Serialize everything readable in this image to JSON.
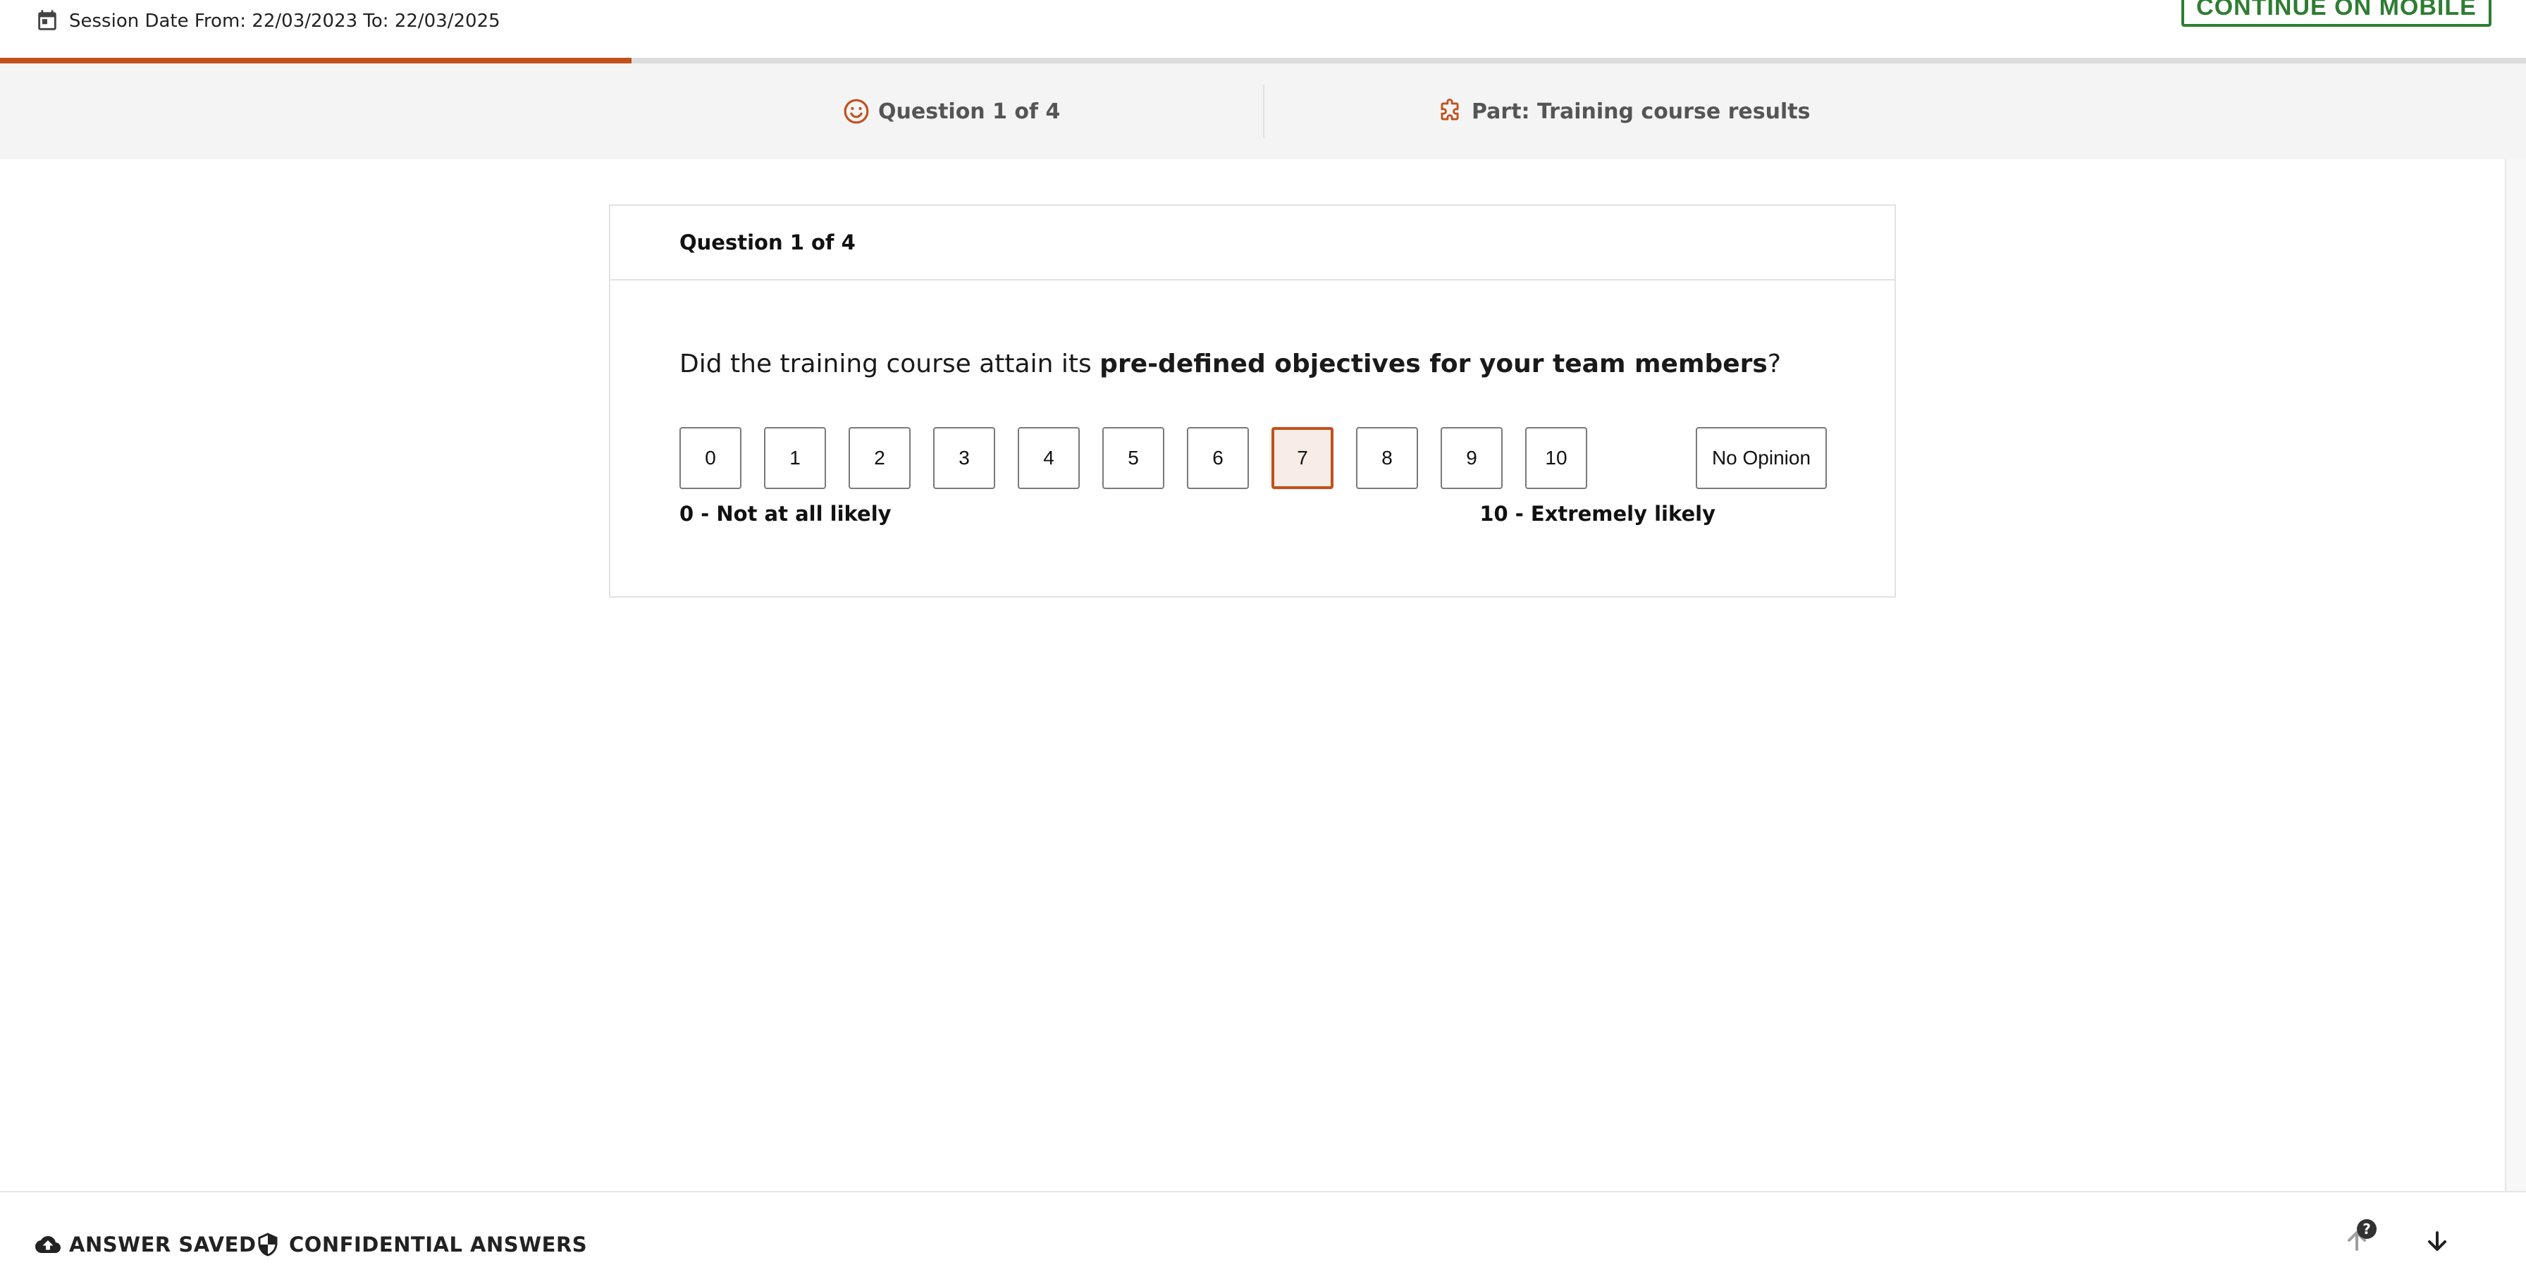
{
  "header": {
    "session_text": "Session Date From: 22/03/2023 To: 22/03/2025",
    "continue_mobile_label": "CONTINUE ON MOBILE"
  },
  "progress": {
    "fraction": 0.25
  },
  "strip": {
    "question_label": "Question 1 of 4",
    "part_label": "Part: Training course results"
  },
  "card": {
    "title": "Question 1 of 4",
    "question_prefix": "Did the training course attain its ",
    "question_bold": "pre-defined objectives for your team members",
    "question_suffix": "?",
    "scale_options": [
      "0",
      "1",
      "2",
      "3",
      "4",
      "5",
      "6",
      "7",
      "8",
      "9",
      "10"
    ],
    "selected_value": "7",
    "no_opinion_label": "No Opinion",
    "min_label": "0 - Not at all likely",
    "max_label": "10 - Extremely likely"
  },
  "footer": {
    "saved_label": "ANSWER SAVED",
    "confidential_label": "CONFIDENTIAL ANSWERS",
    "help_badge": "?"
  },
  "colors": {
    "accent": "#c2501c",
    "mobile_button": "#2e7d32",
    "selected_bg": "#f8ece6"
  },
  "icons": {
    "calendar": "calendar-icon",
    "smiley": "smiley-icon",
    "puzzle": "puzzle-icon",
    "cloud_upload": "cloud-upload-icon",
    "shield": "shield-icon",
    "arrow_up": "arrow-up-icon",
    "arrow_down": "arrow-down-icon"
  }
}
